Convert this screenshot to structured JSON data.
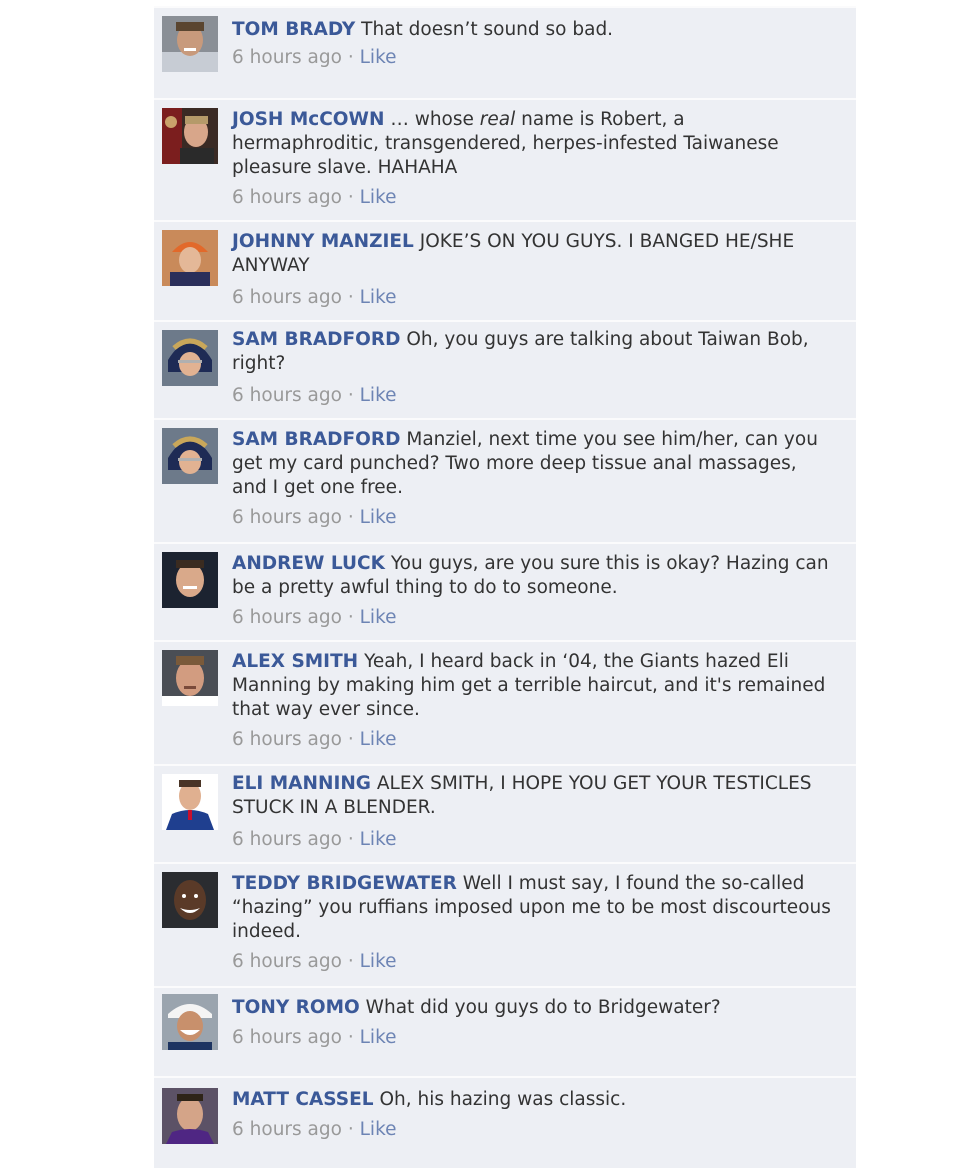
{
  "comments": [
    {
      "author": "TOM BRADY",
      "text": "That doesn’t sound so bad.",
      "time": "6 hours ago",
      "like": "Like",
      "avatar": "tom-brady-avatar"
    },
    {
      "author": "JOSH McCOWN",
      "text_before": " … whose ",
      "text_em": "real",
      "text_after": " name is Robert, a hermaphroditic, transgendered, herpes-infested Taiwanese pleasure slave. HAHAHA",
      "time": "6 hours ago",
      "like": "Like",
      "avatar": "josh-mccown-avatar"
    },
    {
      "author": "JOHNNY MANZIEL",
      "text": "JOKE’S ON YOU GUYS. I BANGED HE/SHE ANYWAY",
      "time": "6 hours ago",
      "like": "Like",
      "avatar": "johnny-manziel-avatar"
    },
    {
      "author": "SAM BRADFORD",
      "text": "Oh, you guys are talking about Taiwan Bob, right?",
      "time": "6 hours ago",
      "like": "Like",
      "avatar": "sam-bradford-avatar"
    },
    {
      "author": "SAM BRADFORD",
      "text": "Manziel, next time you see him/her, can you get my card punched? Two more deep tissue anal massages, and I get one free.",
      "time": "6 hours ago",
      "like": "Like",
      "avatar": "sam-bradford-avatar"
    },
    {
      "author": "ANDREW LUCK",
      "text": "You guys, are you sure this is okay? Hazing can be a pretty awful thing to do to someone.",
      "time": "6 hours ago",
      "like": "Like",
      "avatar": "andrew-luck-avatar"
    },
    {
      "author": "ALEX SMITH",
      "text": "Yeah, I heard back in ‘04, the Giants hazed Eli Manning by making him get a terrible haircut, and it's remained that way ever since.",
      "time": "6 hours ago",
      "like": "Like",
      "avatar": "alex-smith-avatar"
    },
    {
      "author": "ELI MANNING",
      "text": "ALEX SMITH, I HOPE YOU GET YOUR TESTICLES STUCK IN A BLENDER.",
      "time": "6 hours ago",
      "like": "Like",
      "avatar": "eli-manning-avatar"
    },
    {
      "author": "TEDDY BRIDGEWATER",
      "text": "Well I must say, I found the so-called “hazing” you ruffians imposed upon me to be most discourteous indeed.",
      "time": "6 hours ago",
      "like": "Like",
      "avatar": "teddy-bridgewater-avatar"
    },
    {
      "author": "TONY ROMO",
      "text": "What did you guys do to Bridgewater?",
      "time": "6 hours ago",
      "like": "Like",
      "avatar": "tony-romo-avatar"
    },
    {
      "author": "MATT CASSEL",
      "text": "Oh, his hazing was classic.",
      "time": "6 hours ago",
      "like": "Like",
      "avatar": "matt-cassel-avatar"
    }
  ],
  "separator": "·",
  "colors": {
    "author": "#3b5998",
    "like": "#6d84b4",
    "meta": "#999999",
    "text": "#333333",
    "background": "#edeff4"
  }
}
